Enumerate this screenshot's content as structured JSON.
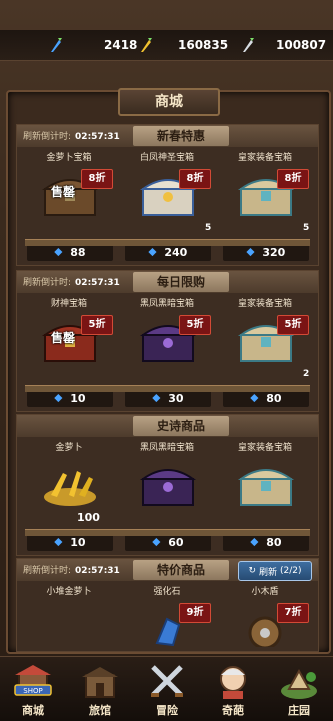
{
  "resources": [
    {
      "icon": "blue-carrot-gem-icon",
      "value": "2418"
    },
    {
      "icon": "gold-carrot-icon",
      "value": "160835"
    },
    {
      "icon": "silver-carrot-icon",
      "value": "100807"
    }
  ],
  "shop_title": "商城",
  "sections": [
    {
      "timer_label": "刷新倒计时:",
      "timer": "02:57:31",
      "title": "新春特惠",
      "items": [
        {
          "name": "金萝卜宝箱",
          "discount": "8折",
          "price": "88",
          "sold_out": "售罄",
          "stock": ""
        },
        {
          "name": "白凤神圣宝箱",
          "discount": "8折",
          "price": "240",
          "sold_out": "",
          "stock": "5"
        },
        {
          "name": "皇家装备宝箱",
          "discount": "8折",
          "price": "320",
          "sold_out": "",
          "stock": "5"
        }
      ]
    },
    {
      "timer_label": "刷新倒计时:",
      "timer": "02:57:31",
      "title": "每日限购",
      "items": [
        {
          "name": "财神宝箱",
          "discount": "5折",
          "price": "10",
          "sold_out": "售罄",
          "stock": ""
        },
        {
          "name": "黑凤黑暗宝箱",
          "discount": "5折",
          "price": "30",
          "sold_out": "",
          "stock": ""
        },
        {
          "name": "皇家装备宝箱",
          "discount": "5折",
          "price": "80",
          "sold_out": "",
          "stock": "2"
        }
      ]
    },
    {
      "timer_label": "",
      "timer": "",
      "title": "史诗商品",
      "items": [
        {
          "name": "金萝卜",
          "discount": "",
          "price": "10",
          "sold_out": "",
          "stock": "",
          "amount": "100"
        },
        {
          "name": "黑凤黑暗宝箱",
          "discount": "",
          "price": "60",
          "sold_out": "",
          "stock": ""
        },
        {
          "name": "皇家装备宝箱",
          "discount": "",
          "price": "80",
          "sold_out": "",
          "stock": ""
        }
      ]
    },
    {
      "timer_label": "刷新倒计时:",
      "timer": "02:57:31",
      "title": "特价商品",
      "refresh_label": "刷新",
      "refresh_count": "(2/2)",
      "items": [
        {
          "name": "小堆金萝卜",
          "discount": "",
          "price": "",
          "sold_out": "",
          "stock": ""
        },
        {
          "name": "强化石",
          "discount": "9折",
          "price": "",
          "sold_out": "",
          "stock": ""
        },
        {
          "name": "小木盾",
          "discount": "7折",
          "price": "",
          "sold_out": "",
          "stock": ""
        }
      ]
    }
  ],
  "nav": [
    {
      "label": "商城",
      "icon": "shop-icon",
      "badge": "SHOP"
    },
    {
      "label": "旅馆",
      "icon": "inn-icon"
    },
    {
      "label": "冒险",
      "icon": "crossed-swords-icon"
    },
    {
      "label": "奇葩",
      "icon": "character-icon"
    },
    {
      "label": "庄园",
      "icon": "manor-icon"
    }
  ]
}
